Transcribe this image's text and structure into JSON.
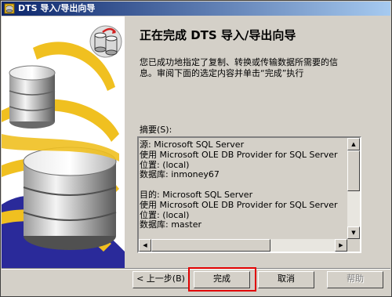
{
  "window": {
    "title": "DTS 导入/导出向导"
  },
  "header": {
    "heading": "正在完成 DTS 导入/导出向导",
    "description_lines": [
      "您已成功地指定了复制、转换或传输数据所需要的信",
      "息。审阅下面的选定内容并单击“完成”执行"
    ]
  },
  "summary": {
    "label": "摘要(S):",
    "lines": [
      "源: Microsoft SQL Server",
      "使用 Microsoft OLE DB Provider for SQL Server",
      "位置: (local)",
      "数据库: inmoney67",
      "",
      "目的: Microsoft SQL Server",
      "使用 Microsoft OLE DB Provider for SQL Server",
      "位置: (local)",
      "数据库: master"
    ]
  },
  "buttons": {
    "back": "< 上一步(B)",
    "finish": "完成",
    "cancel": "取消",
    "help": "帮助"
  },
  "icons": {
    "title": "database-wizard-icon",
    "header": "database-copy-icon",
    "illustration": "database-transfer-illustration"
  },
  "colors": {
    "titlebar_start": "#0a246a",
    "titlebar_end": "#a6caf0",
    "dialog_bg": "#d4d0c8",
    "illustration_blue": "#2a2a9a",
    "illustration_yellow": "#f0c020",
    "highlight": "#e00000"
  }
}
